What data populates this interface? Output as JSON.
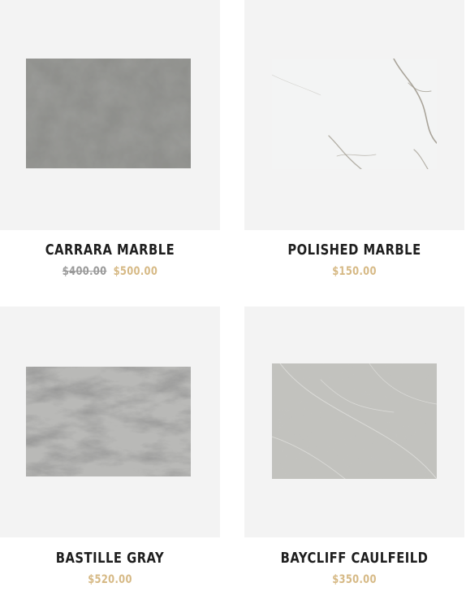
{
  "colors": {
    "card_background": "#f3f3f3",
    "title_text": "#1e1e1e",
    "sale_price": "#d6b985",
    "old_price": "#9a9a9a"
  },
  "products": [
    {
      "name": "CARRARA MARBLE",
      "old_price": "$400.00",
      "price": "$500.00",
      "image": "carrara-marble-swatch"
    },
    {
      "name": "POLISHED MARBLE",
      "price": "$150.00",
      "image": "polished-marble-swatch"
    },
    {
      "name": "BASTILLE GRAY",
      "price": "$520.00",
      "image": "bastille-gray-swatch"
    },
    {
      "name": "BAYCLIFF CAULFEILD",
      "price": "$350.00",
      "image": "baycliff-caulfeild-swatch"
    }
  ]
}
